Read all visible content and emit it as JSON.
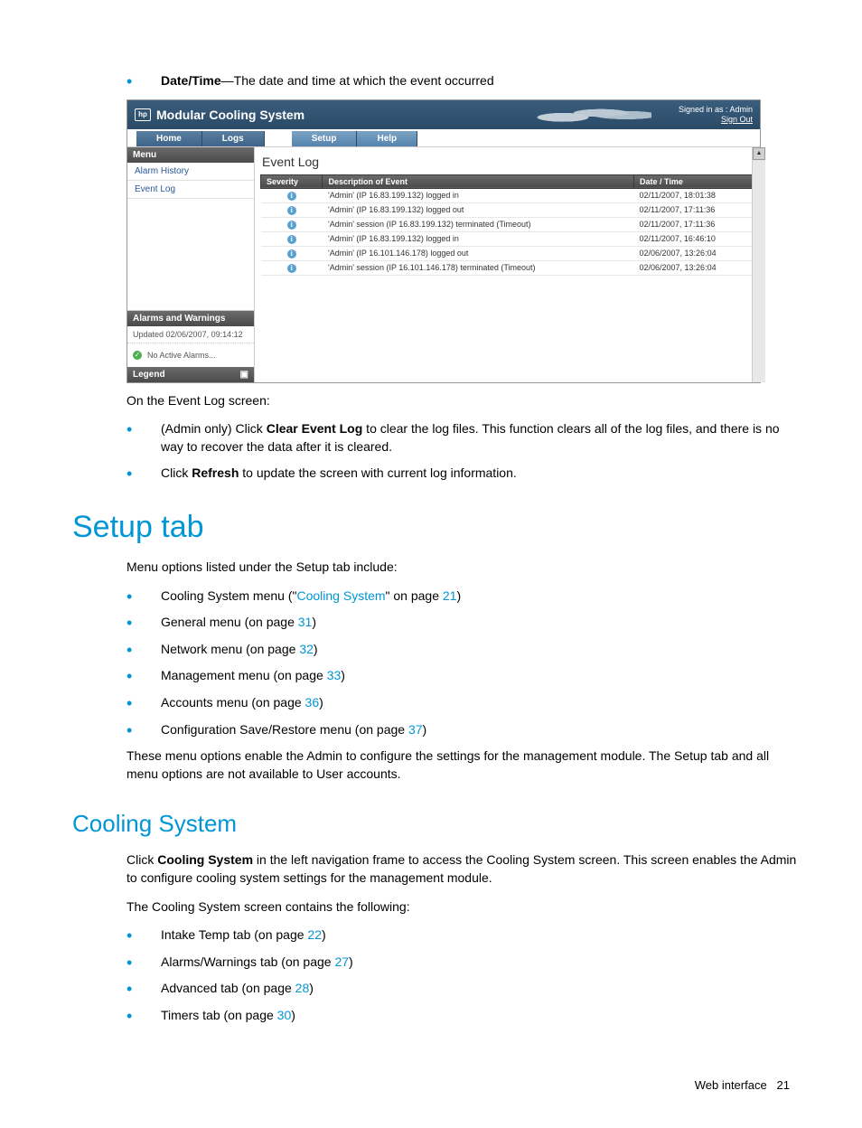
{
  "intro_bullet": {
    "label": "Date/Time",
    "text": "—The date and time at which the event occurred"
  },
  "screenshot": {
    "product_title": "Modular Cooling System",
    "logo_text": "hp",
    "signed_in": "Signed in as : Admin",
    "sign_out": "Sign Out",
    "tabs": [
      "Home",
      "Logs",
      "Setup",
      "Help"
    ],
    "sidebar": {
      "menu_header": "Menu",
      "items": [
        "Alarm History",
        "Event Log"
      ],
      "alarms_header": "Alarms and Warnings",
      "updated": "Updated 02/06/2007, 09:14:12",
      "no_alarms": "No Active Alarms...",
      "legend": "Legend"
    },
    "main": {
      "title": "Event Log",
      "columns": [
        "Severity",
        "Description of Event",
        "Date / Time"
      ],
      "rows": [
        {
          "desc": "'Admin' (IP 16.83.199.132) logged in",
          "dt": "02/11/2007, 18:01:38"
        },
        {
          "desc": "'Admin' (IP 16.83.199.132) logged out",
          "dt": "02/11/2007, 17:11:36"
        },
        {
          "desc": "'Admin' session (IP 16.83.199.132) terminated (Timeout)",
          "dt": "02/11/2007, 17:11:36"
        },
        {
          "desc": "'Admin' (IP 16.83.199.132) logged in",
          "dt": "02/11/2007, 16:46:10"
        },
        {
          "desc": "'Admin' (IP 16.101.146.178) logged out",
          "dt": "02/06/2007, 13:26:04"
        },
        {
          "desc": "'Admin' session (IP 16.101.146.178) terminated (Timeout)",
          "dt": "02/06/2007, 13:26:04"
        }
      ]
    }
  },
  "after_screenshot": "On the Event Log screen:",
  "after_bullets": [
    {
      "pre": "(Admin only) Click ",
      "bold": "Clear Event Log",
      "post": " to clear the log files. This function clears all of the log files, and there is no way to recover the data after it is cleared."
    },
    {
      "pre": "Click ",
      "bold": "Refresh",
      "post": " to update the screen with current log information."
    }
  ],
  "setup": {
    "heading": "Setup tab",
    "intro": "Menu options listed under the Setup tab include:",
    "items": [
      {
        "pre": "Cooling System menu (\"",
        "link": "Cooling System",
        "mid": "\" on page ",
        "page": "21",
        "post": ")"
      },
      {
        "pre": "General menu (on page ",
        "link": "",
        "mid": "",
        "page": "31",
        "post": ")"
      },
      {
        "pre": "Network menu (on page ",
        "link": "",
        "mid": "",
        "page": "32",
        "post": ")"
      },
      {
        "pre": "Management menu (on page ",
        "link": "",
        "mid": "",
        "page": "33",
        "post": ")"
      },
      {
        "pre": "Accounts menu (on page ",
        "link": "",
        "mid": "",
        "page": "36",
        "post": ")"
      },
      {
        "pre": "Configuration Save/Restore menu (on page ",
        "link": "",
        "mid": "",
        "page": "37",
        "post": ")"
      }
    ],
    "closing": "These menu options enable the Admin to configure the settings for the management module. The Setup tab and all menu options are not available to User accounts."
  },
  "cooling": {
    "heading": "Cooling System",
    "p1_pre": "Click ",
    "p1_bold": "Cooling System",
    "p1_post": " in the left navigation frame to access the Cooling System screen. This screen enables the Admin to configure cooling system settings for the management module.",
    "p2": "The Cooling System screen contains the following:",
    "items": [
      {
        "text": "Intake Temp tab (on page ",
        "page": "22",
        "post": ")"
      },
      {
        "text": "Alarms/Warnings tab (on page ",
        "page": "27",
        "post": ")"
      },
      {
        "text": "Advanced tab (on page ",
        "page": "28",
        "post": ")"
      },
      {
        "text": "Timers tab (on page ",
        "page": "30",
        "post": ")"
      }
    ]
  },
  "footer": {
    "label": "Web interface",
    "page": "21"
  }
}
